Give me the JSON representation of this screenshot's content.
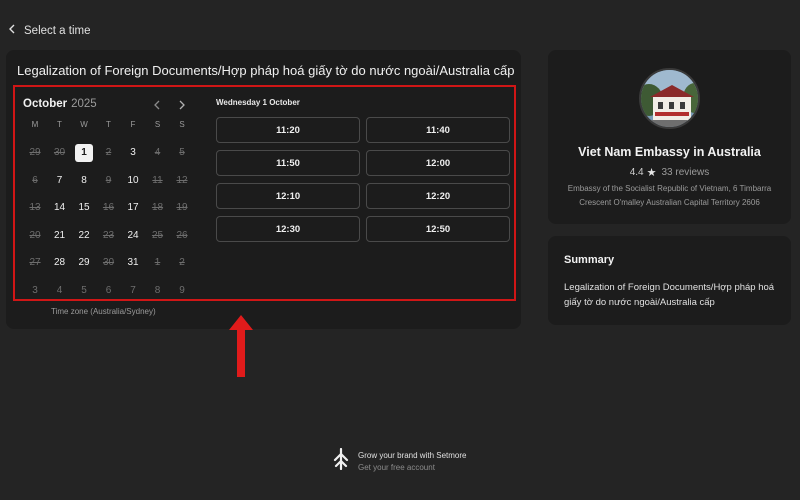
{
  "header": {
    "back_label": "Select a time"
  },
  "service": {
    "title": "Legalization of Foreign Documents/Hợp pháp hoá giấy tờ do nước ngoài/Australia cấp",
    "timezone": "Time zone (Australia/Sydney)"
  },
  "calendar": {
    "month": "October",
    "year": "2025",
    "weekdays": [
      "M",
      "T",
      "W",
      "T",
      "F",
      "S",
      "S"
    ],
    "weeks": [
      [
        {
          "d": "29",
          "s": "unavail"
        },
        {
          "d": "30",
          "s": "unavail"
        },
        {
          "d": "1",
          "s": "selected"
        },
        {
          "d": "2",
          "s": "unavail"
        },
        {
          "d": "3",
          "s": "avail"
        },
        {
          "d": "4",
          "s": "unavail"
        },
        {
          "d": "5",
          "s": "unavail"
        }
      ],
      [
        {
          "d": "6",
          "s": "unavail"
        },
        {
          "d": "7",
          "s": "avail"
        },
        {
          "d": "8",
          "s": "avail"
        },
        {
          "d": "9",
          "s": "unavail"
        },
        {
          "d": "10",
          "s": "avail"
        },
        {
          "d": "11",
          "s": "unavail"
        },
        {
          "d": "12",
          "s": "unavail"
        }
      ],
      [
        {
          "d": "13",
          "s": "unavail"
        },
        {
          "d": "14",
          "s": "avail"
        },
        {
          "d": "15",
          "s": "avail"
        },
        {
          "d": "16",
          "s": "unavail"
        },
        {
          "d": "17",
          "s": "avail"
        },
        {
          "d": "18",
          "s": "unavail"
        },
        {
          "d": "19",
          "s": "unavail"
        }
      ],
      [
        {
          "d": "20",
          "s": "unavail"
        },
        {
          "d": "21",
          "s": "avail"
        },
        {
          "d": "22",
          "s": "avail"
        },
        {
          "d": "23",
          "s": "unavail"
        },
        {
          "d": "24",
          "s": "avail"
        },
        {
          "d": "25",
          "s": "unavail"
        },
        {
          "d": "26",
          "s": "unavail"
        }
      ],
      [
        {
          "d": "27",
          "s": "unavail"
        },
        {
          "d": "28",
          "s": "avail"
        },
        {
          "d": "29",
          "s": "avail"
        },
        {
          "d": "30",
          "s": "unavail"
        },
        {
          "d": "31",
          "s": "avail"
        },
        {
          "d": "1",
          "s": "unavail"
        },
        {
          "d": "2",
          "s": "unavail"
        }
      ],
      [
        {
          "d": "3",
          "s": "outside"
        },
        {
          "d": "4",
          "s": "outside"
        },
        {
          "d": "5",
          "s": "outside"
        },
        {
          "d": "6",
          "s": "outside"
        },
        {
          "d": "7",
          "s": "outside"
        },
        {
          "d": "8",
          "s": "outside"
        },
        {
          "d": "9",
          "s": "outside"
        }
      ]
    ]
  },
  "times": {
    "date_label": "Wednesday 1 October",
    "slots": [
      "11:20",
      "11:40",
      "11:50",
      "12:00",
      "12:10",
      "12:20",
      "12:30",
      "12:50"
    ]
  },
  "business": {
    "name": "Viet Nam Embassy in Australia",
    "rating": "4.4",
    "reviews": "33 reviews",
    "address": "Embassy of the Socialist Republic of Vietnam, 6 Timbarra Crescent O'malley Australian Capital Territory 2606"
  },
  "summary": {
    "title": "Summary",
    "text": "Legalization of Foreign Documents/Hợp pháp hoá giấy tờ do nước ngoài/Australia cấp"
  },
  "footer": {
    "line1": "Grow your brand with Setmore",
    "line2": "Get your free account"
  },
  "icons": {
    "back": "chevron-left-icon",
    "prev_month": "chevron-left-icon",
    "next_month": "chevron-right-icon",
    "star": "star-icon",
    "brand": "setmore-logo-icon",
    "annotation": "red-up-arrow"
  },
  "colors": {
    "background": "#242424",
    "card": "#1c1c1c",
    "highlight_box": "#d01616",
    "annotation_arrow": "#e01b1b"
  }
}
